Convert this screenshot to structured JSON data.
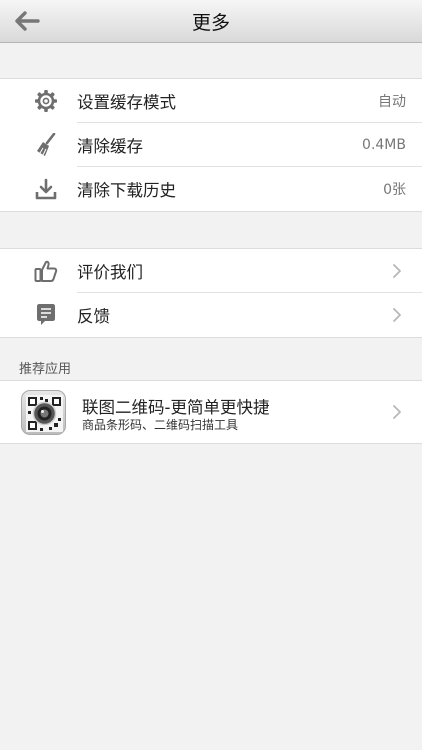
{
  "header": {
    "title": "更多",
    "back_icon": "arrow-left-icon"
  },
  "settings_group": {
    "items": [
      {
        "icon": "gear-icon",
        "label": "设置缓存模式",
        "value": "自动"
      },
      {
        "icon": "broom-icon",
        "label": "清除缓存",
        "value": "0.4MB"
      },
      {
        "icon": "download-icon",
        "label": "清除下载历史",
        "value": "0张"
      }
    ]
  },
  "feedback_group": {
    "items": [
      {
        "icon": "thumbs-up-icon",
        "label": "评价我们"
      },
      {
        "icon": "message-icon",
        "label": "反馈"
      }
    ]
  },
  "recommended": {
    "header": "推荐应用",
    "apps": [
      {
        "icon": "qr-camera-app-icon",
        "title": "联图二维码-更简单更快捷",
        "subtitle": "商品条形码、二维码扫描工具"
      }
    ]
  },
  "colors": {
    "icon_gray": "#6e6e6e",
    "chevron": "#b8b8b8",
    "background": "#f2f2f2"
  }
}
